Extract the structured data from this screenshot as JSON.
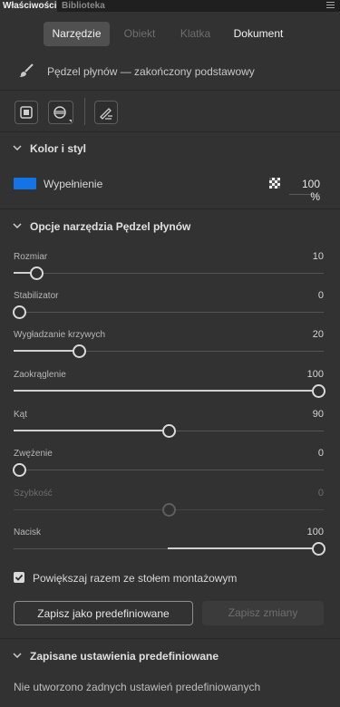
{
  "panel_tabs": [
    "Właściwości",
    "Biblioteka"
  ],
  "segments": [
    "Narzędzie",
    "Obiekt",
    "Klatka",
    "Dokument"
  ],
  "tool": {
    "icon": "brush-icon",
    "name": "Pędzel płynów — zakończony podstawowy"
  },
  "toolbar_icons": [
    "object-drawing-mode-icon",
    "brush-mode-icon",
    "pressure-pen-icon"
  ],
  "sections": {
    "color": "Kolor i styl",
    "tool_options": "Opcje narzędzia Pędzel płynów",
    "presets": "Zapisane ustawienia predefiniowane"
  },
  "fill": {
    "label": "Wypełnienie",
    "color": "#1473e6",
    "opacity": "100 %"
  },
  "sliders": [
    {
      "label": "Rozmiar",
      "value": "10",
      "fraction": 0.06,
      "enabled": true
    },
    {
      "label": "Stabilizator",
      "value": "0",
      "fraction": 0.0,
      "enabled": true
    },
    {
      "label": "Wygładzanie krzywych",
      "value": "20",
      "fraction": 0.2,
      "enabled": true
    },
    {
      "label": "Zaokrąglenie",
      "value": "100",
      "fraction": 1.0,
      "enabled": true
    },
    {
      "label": "Kąt",
      "value": "90",
      "fraction": 0.5,
      "enabled": true
    },
    {
      "label": "Zwężenie",
      "value": "0",
      "fraction": 0.0,
      "enabled": true
    },
    {
      "label": "Szybkość",
      "value": "0",
      "fraction": 0.5,
      "enabled": false
    },
    {
      "label": "Nacisk",
      "value": "100",
      "fraction": 1.0,
      "enabled": true
    }
  ],
  "checkbox": {
    "label": "Powiększaj razem ze stołem montażowym",
    "checked": true
  },
  "buttons": {
    "save_preset": "Zapisz jako predefiniowane",
    "save_changes": "Zapisz zmiany"
  },
  "presets_empty": "Nie utworzono żadnych ustawień predefiniowanych"
}
